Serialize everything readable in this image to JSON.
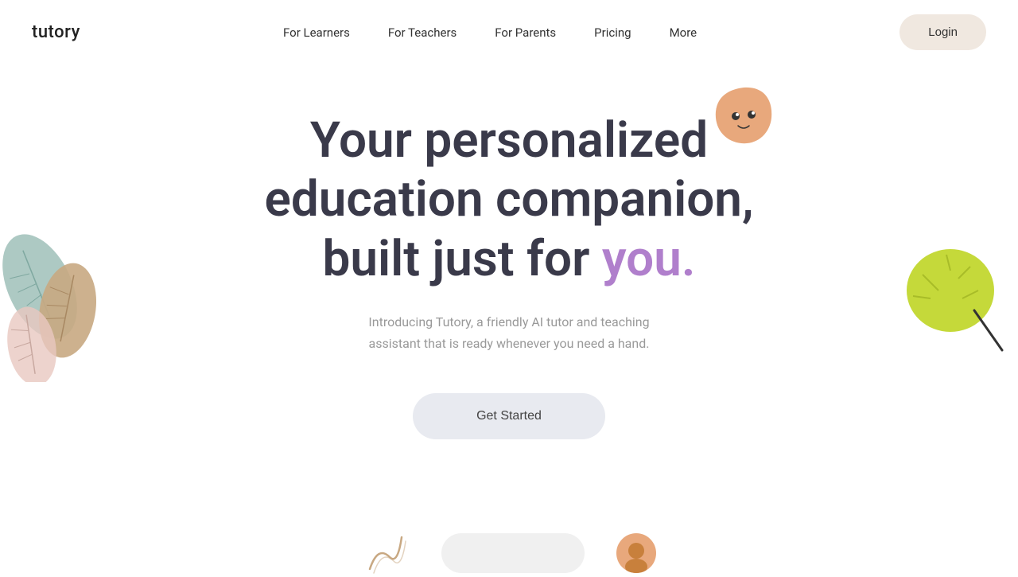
{
  "brand": {
    "logo": "tutory"
  },
  "nav": {
    "links": [
      {
        "label": "For Learners",
        "id": "for-learners"
      },
      {
        "label": "For Teachers",
        "id": "for-teachers"
      },
      {
        "label": "For Parents",
        "id": "for-parents"
      },
      {
        "label": "Pricing",
        "id": "pricing"
      },
      {
        "label": "More",
        "id": "more"
      }
    ],
    "login_label": "Login"
  },
  "hero": {
    "title_part1": "Your personalized",
    "title_part2": "education companion,",
    "title_part3": "built just for ",
    "title_highlight": "you.",
    "subtitle": "Introducing Tutory, a friendly AI tutor and teaching assistant that is ready whenever you need a hand.",
    "cta_label": "Get Started"
  },
  "colors": {
    "accent_purple": "#b07fcc",
    "login_bg": "#f0e8e0",
    "cta_bg": "#e8eaf0",
    "blob_peach": "#e8a87c",
    "tree_green": "#c5d93a",
    "leaf_teal": "#9fbfb8",
    "leaf_tan": "#c8a882",
    "leaf_pink": "#e8c8c0"
  }
}
